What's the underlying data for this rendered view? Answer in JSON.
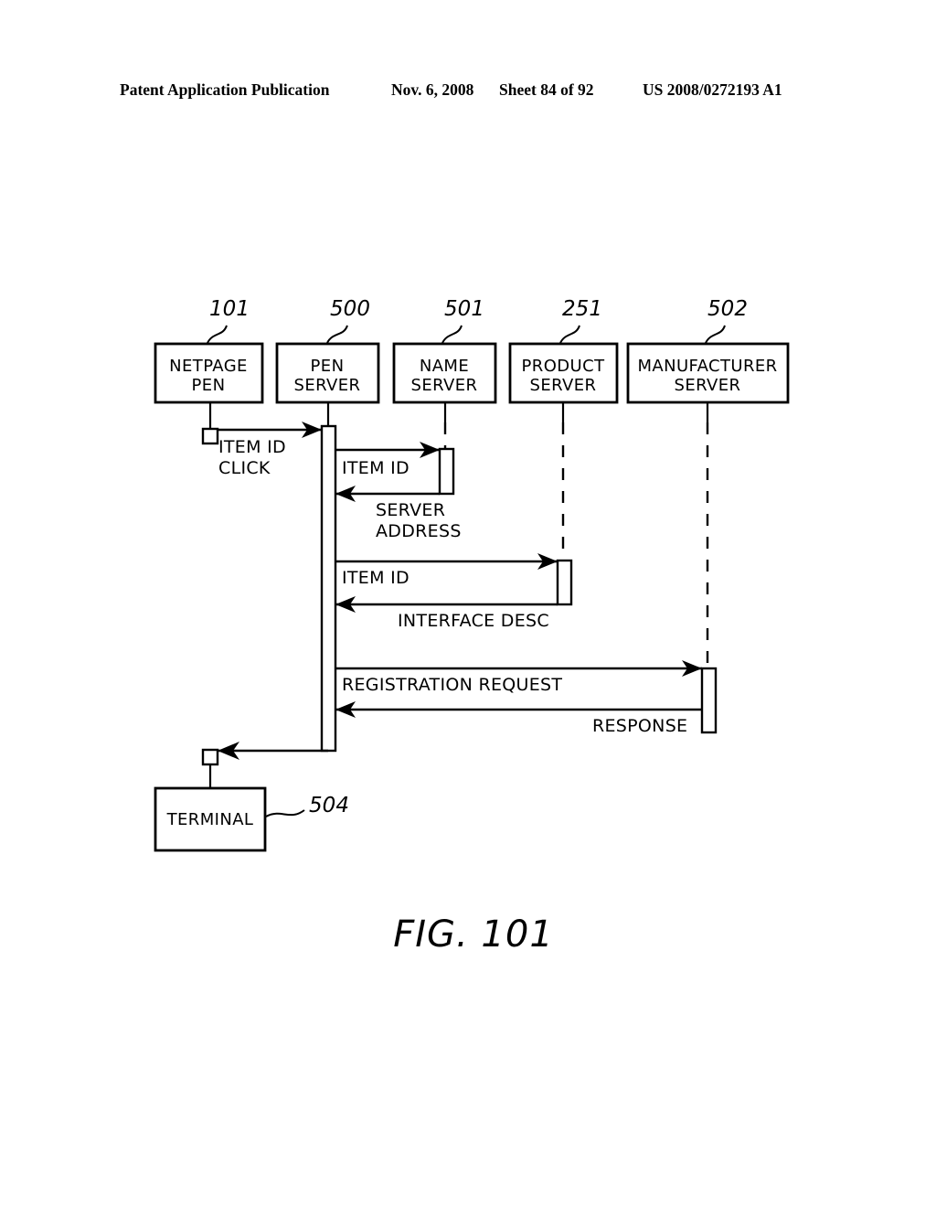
{
  "header": {
    "publication": "Patent Application Publication",
    "date": "Nov. 6, 2008",
    "sheet": "Sheet 84 of 92",
    "patent_number": "US 2008/0272193 A1"
  },
  "figure": {
    "caption": "FIG. 101",
    "type": "sequence-diagram"
  },
  "participants": [
    {
      "id": "netpage-pen",
      "label_line1": "NETPAGE",
      "label_line2": "PEN",
      "ref": "101"
    },
    {
      "id": "pen-server",
      "label_line1": "PEN",
      "label_line2": "SERVER",
      "ref": "500"
    },
    {
      "id": "name-server",
      "label_line1": "NAME",
      "label_line2": "SERVER",
      "ref": "501"
    },
    {
      "id": "product-server",
      "label_line1": "PRODUCT",
      "label_line2": "SERVER",
      "ref": "251"
    },
    {
      "id": "manufacturer-server",
      "label_line1": "MANUFACTURER",
      "label_line2": "SERVER",
      "ref": "502"
    }
  ],
  "terminal": {
    "label": "TERMINAL",
    "ref": "504"
  },
  "messages": [
    {
      "id": "msg-item-id-click",
      "label_line1": "ITEM ID",
      "label_line2": "CLICK",
      "from": "netpage-pen",
      "to": "pen-server",
      "direction": "right"
    },
    {
      "id": "msg-item-id-name",
      "label_line1": "ITEM ID",
      "label_line2": "",
      "from": "pen-server",
      "to": "name-server",
      "direction": "right"
    },
    {
      "id": "msg-server-address",
      "label_line1": "SERVER",
      "label_line2": "ADDRESS",
      "from": "name-server",
      "to": "pen-server",
      "direction": "left"
    },
    {
      "id": "msg-item-id-product",
      "label_line1": "ITEM ID",
      "label_line2": "",
      "from": "pen-server",
      "to": "product-server",
      "direction": "right"
    },
    {
      "id": "msg-interface-desc",
      "label_line1": "INTERFACE DESC",
      "label_line2": "",
      "from": "product-server",
      "to": "pen-server",
      "direction": "left"
    },
    {
      "id": "msg-registration-request",
      "label_line1": "REGISTRATION REQUEST",
      "label_line2": "",
      "from": "pen-server",
      "to": "manufacturer-server",
      "direction": "right"
    },
    {
      "id": "msg-response",
      "label_line1": "RESPONSE",
      "label_line2": "",
      "from": "manufacturer-server",
      "to": "pen-server",
      "direction": "left"
    },
    {
      "id": "msg-to-terminal",
      "label_line1": "",
      "label_line2": "",
      "from": "pen-server",
      "to": "terminal",
      "direction": "left"
    }
  ],
  "colors": {
    "ink": "#000000",
    "paper": "#ffffff"
  }
}
